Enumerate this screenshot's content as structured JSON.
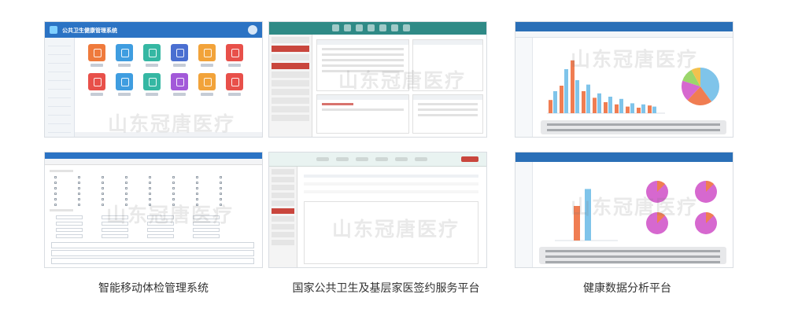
{
  "watermark": "山东冠唐医疗",
  "captions": [
    "智能移动体检管理系统",
    "国家公共卫生及基层家医签约服务平台",
    "健康数据分析平台"
  ],
  "thumb1": {
    "title": "公共卫生健康管理系统",
    "tile_colors": [
      "#ef7a3c",
      "#3f9de0",
      "#35b7a3",
      "#4a6fd1",
      "#f2a33a",
      "#e8504a",
      "#e8504a",
      "#3f9de0",
      "#35b7a3",
      "#a259d9",
      "#f2a33a",
      "#e8504a"
    ]
  },
  "colors": {
    "header_blue": "#2b73c4",
    "teal": "#2f8a86",
    "accent_red": "#c9463d",
    "bar_orange": "#f07d52",
    "bar_blue": "#7fc4ea",
    "pie_magenta": "#d668cf"
  },
  "chart_data": [
    {
      "type": "bar",
      "categories": [
        "",
        "",
        "",
        "",
        "",
        "",
        "",
        "",
        "",
        ""
      ],
      "series": [
        {
          "values": [
            12,
            25,
            48,
            20,
            14,
            10,
            8,
            6,
            5,
            7
          ]
        },
        {
          "values": [
            20,
            40,
            30,
            26,
            18,
            15,
            13,
            9,
            8,
            6
          ]
        }
      ]
    },
    {
      "type": "pie",
      "values": [
        40,
        22,
        18,
        12,
        8
      ]
    },
    {
      "type": "bar",
      "categories": [
        "",
        ""
      ],
      "series": [
        {
          "values": [
            55
          ]
        },
        {
          "values": [
            82
          ]
        }
      ]
    }
  ]
}
